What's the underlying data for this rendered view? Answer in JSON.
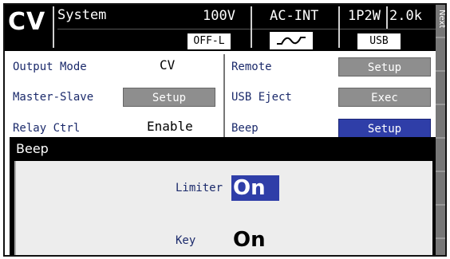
{
  "header": {
    "mode": "CV",
    "title": "System",
    "voltage": "100V",
    "source": "AC-INT",
    "phase": "1P2W",
    "power": "2.0k",
    "output_state": "OFF-L",
    "usb": "USB"
  },
  "side": {
    "next_label": "Next"
  },
  "menu": {
    "output_mode": {
      "label": "Output Mode",
      "value": "CV"
    },
    "master_slave": {
      "label": "Master-Slave",
      "button": "Setup"
    },
    "relay_ctrl": {
      "label": "Relay Ctrl",
      "value": "Enable"
    },
    "remote": {
      "label": "Remote",
      "button": "Setup"
    },
    "usb_eject": {
      "label": "USB Eject",
      "button": "Exec"
    },
    "beep": {
      "label": "Beep",
      "button": "Setup"
    }
  },
  "popup": {
    "title": "Beep",
    "limiter": {
      "label": "Limiter",
      "value": "On"
    },
    "key": {
      "label": "Key",
      "value": "On"
    }
  },
  "colors": {
    "accent": "#2f3ea8",
    "button": "#8e8e8e",
    "label": "#1b2a6b"
  }
}
